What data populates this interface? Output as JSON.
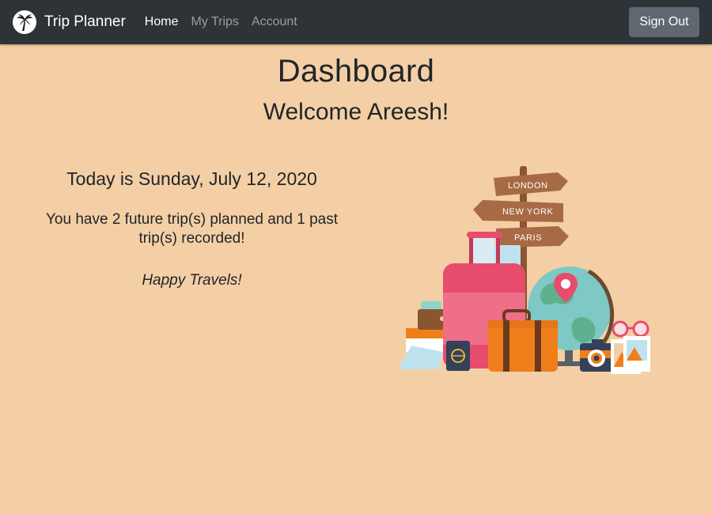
{
  "nav": {
    "brand": "Trip Planner",
    "links": [
      {
        "label": "Home",
        "active": true
      },
      {
        "label": "My Trips",
        "active": false
      },
      {
        "label": "Account",
        "active": false
      }
    ],
    "sign_out": "Sign Out"
  },
  "main": {
    "title": "Dashboard",
    "welcome": "Welcome Areesh!",
    "today": "Today is Sunday, July 12, 2020",
    "trips_summary": "You have 2 future trip(s) planned and 1 past trip(s) recorded!",
    "tagline": "Happy Travels!"
  },
  "illustration": {
    "signs": [
      "LONDON",
      "NEW YORK",
      "PARIS"
    ]
  },
  "colors": {
    "navbar": "#2e3338",
    "background": "#f4cfa5",
    "signout_button": "#5f6770",
    "sign": "#a76a44",
    "suitcase": "#e74c6c",
    "case": "#f07f1b",
    "globe": "#7ec9c5"
  },
  "icons": {
    "brand": "palm-tree-icon"
  }
}
